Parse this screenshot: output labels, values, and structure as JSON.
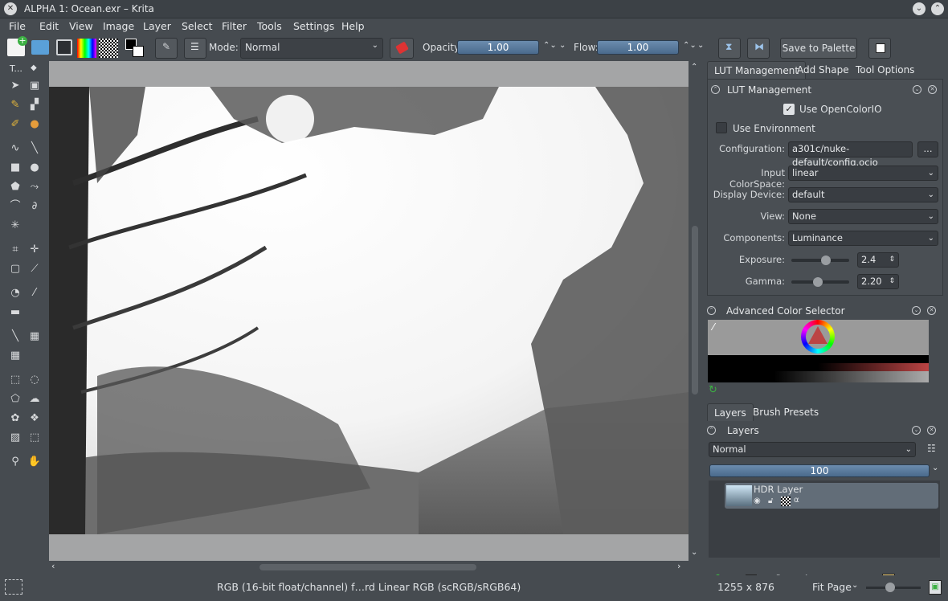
{
  "window": {
    "title": "ALPHA 1: Ocean.exr – Krita"
  },
  "menus": [
    "File",
    "Edit",
    "View",
    "Image",
    "Layer",
    "Select",
    "Filter",
    "Tools",
    "Settings",
    "Help"
  ],
  "toolbar": {
    "mode_label": "Mode:",
    "mode_value": "Normal",
    "opacity_label": "Opacity:",
    "opacity_value": "1.00",
    "flow_label": "Flow:",
    "flow_value": "1.00",
    "save_palette": "Save to Palette"
  },
  "toolbox": {
    "header": "T..."
  },
  "dock_tabs": [
    "LUT Management",
    "Add Shape",
    "Tool Options"
  ],
  "lut": {
    "title": "LUT Management",
    "use_ocio": "Use OpenColorIO",
    "use_env": "Use Environment",
    "config_label": "Configuration:",
    "config_value": "a301c/nuke-default/config.ocio",
    "browse": "...",
    "input_label": "Input ColorSpace:",
    "input_value": "linear",
    "display_label": "Display Device:",
    "display_value": "default",
    "view_label": "View:",
    "view_value": "None",
    "components_label": "Components:",
    "components_value": "Luminance",
    "exposure_label": "Exposure:",
    "exposure_value": "2.4",
    "exposure_level": 0.62,
    "gamma_label": "Gamma:",
    "gamma_value": "2.20",
    "gamma_level": 0.45
  },
  "color_selector": {
    "title": "Advanced Color Selector"
  },
  "layer_tabs": [
    "Layers",
    "Brush Presets"
  ],
  "layers": {
    "title": "Layers",
    "blend": "Normal",
    "opacity": "100",
    "items": [
      {
        "name": "HDR Layer"
      }
    ]
  },
  "status": {
    "colorspace": "RGB (16-bit float/channel)  f…rd Linear RGB (scRGB/sRGB64)",
    "size": "1255 x 876",
    "zoom": "Fit Page"
  },
  "colors": {
    "accent": "#6b8cae",
    "bg": "#464b50"
  }
}
